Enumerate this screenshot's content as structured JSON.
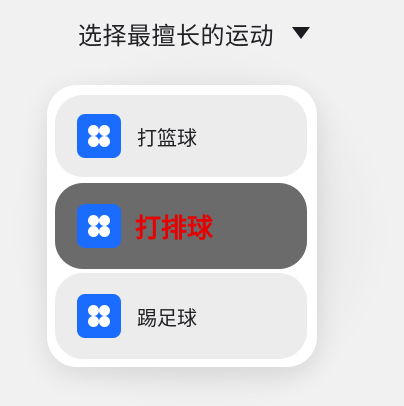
{
  "header": {
    "title": "选择最擅长的运动",
    "dropdown_icon": "caret-down-icon"
  },
  "menu": {
    "selected_index": 1,
    "items": [
      {
        "label": "打篮球",
        "icon": "app-grid-icon"
      },
      {
        "label": "打排球",
        "icon": "app-grid-icon"
      },
      {
        "label": "踢足球",
        "icon": "app-grid-icon"
      }
    ]
  },
  "colors": {
    "icon_background": "#1a6cff",
    "selected_item_background": "#6b6b6b",
    "selected_label": "#e80000",
    "item_background": "#ececec",
    "menu_background": "#ffffff"
  }
}
